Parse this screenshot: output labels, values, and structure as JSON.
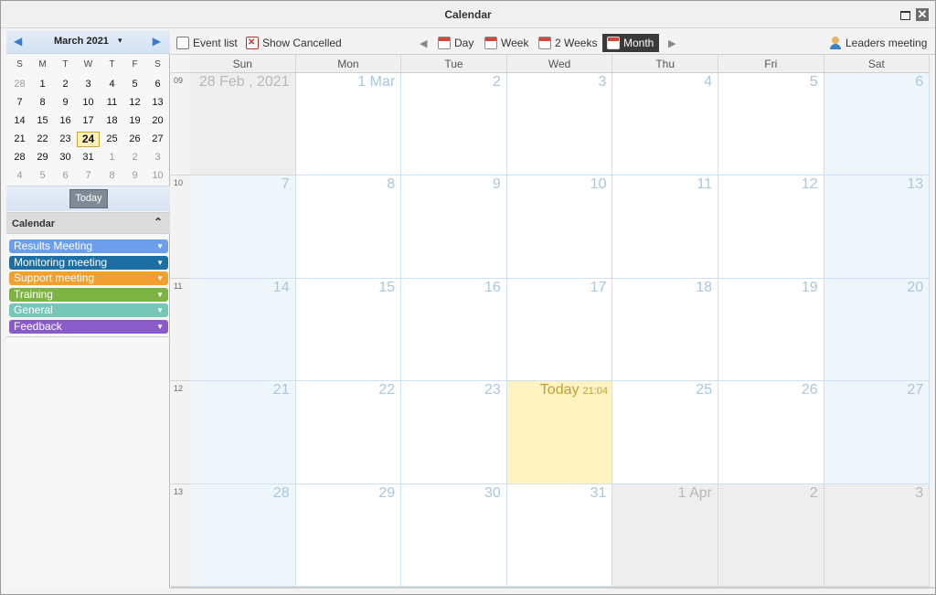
{
  "window": {
    "title": "Calendar",
    "close_glyph": "✕"
  },
  "mini_calendar": {
    "month_label": "March 2021",
    "prev_glyph": "◀",
    "next_glyph": "▶",
    "dropdown_glyph": "▾",
    "weekdays": [
      "S",
      "M",
      "T",
      "W",
      "T",
      "F",
      "S"
    ],
    "weeks": [
      [
        "28",
        "1",
        "2",
        "3",
        "4",
        "5",
        "6"
      ],
      [
        "7",
        "8",
        "9",
        "10",
        "11",
        "12",
        "13"
      ],
      [
        "14",
        "15",
        "16",
        "17",
        "18",
        "19",
        "20"
      ],
      [
        "21",
        "22",
        "23",
        "24",
        "25",
        "26",
        "27"
      ],
      [
        "28",
        "29",
        "30",
        "31",
        "1",
        "2",
        "3"
      ],
      [
        "4",
        "5",
        "6",
        "7",
        "8",
        "9",
        "10"
      ]
    ],
    "today_button": "Today"
  },
  "calendars_panel": {
    "title": "Calendar",
    "collapse_glyph": "⌃",
    "items": [
      {
        "label": "Results Meeting",
        "color": "#6d9eeb"
      },
      {
        "label": "Monitoring meeting",
        "color": "#1d6fa3"
      },
      {
        "label": "Support meeting",
        "color": "#f0a030"
      },
      {
        "label": "Training",
        "color": "#7cb342"
      },
      {
        "label": "General",
        "color": "#76c7b7"
      },
      {
        "label": "Feedback",
        "color": "#8a5cc9"
      }
    ]
  },
  "toolbar": {
    "event_list": "Event list",
    "show_cancelled": "Show Cancelled",
    "prev_glyph": "◀",
    "next_glyph": "▶",
    "views": [
      "Day",
      "Week",
      "2 Weeks",
      "Month"
    ],
    "active_view": "Month",
    "user": "Leaders meeting"
  },
  "month_view": {
    "day_headers": [
      "Sun",
      "Mon",
      "Tue",
      "Wed",
      "Thu",
      "Fri",
      "Sat"
    ],
    "weeks": [
      {
        "number": "09",
        "days": [
          "28 Feb , 2021",
          "1 Mar",
          "2",
          "3",
          "4",
          "5",
          "6"
        ]
      },
      {
        "number": "10",
        "days": [
          "7",
          "8",
          "9",
          "10",
          "11",
          "12",
          "13"
        ]
      },
      {
        "number": "11",
        "days": [
          "14",
          "15",
          "16",
          "17",
          "18",
          "19",
          "20"
        ]
      },
      {
        "number": "12",
        "days": [
          "21",
          "22",
          "23",
          "Today",
          "25",
          "26",
          "27"
        ]
      },
      {
        "number": "13",
        "days": [
          "28",
          "29",
          "30",
          "31",
          "1 Apr",
          "2",
          "3"
        ]
      }
    ],
    "today_time": "21:04"
  }
}
